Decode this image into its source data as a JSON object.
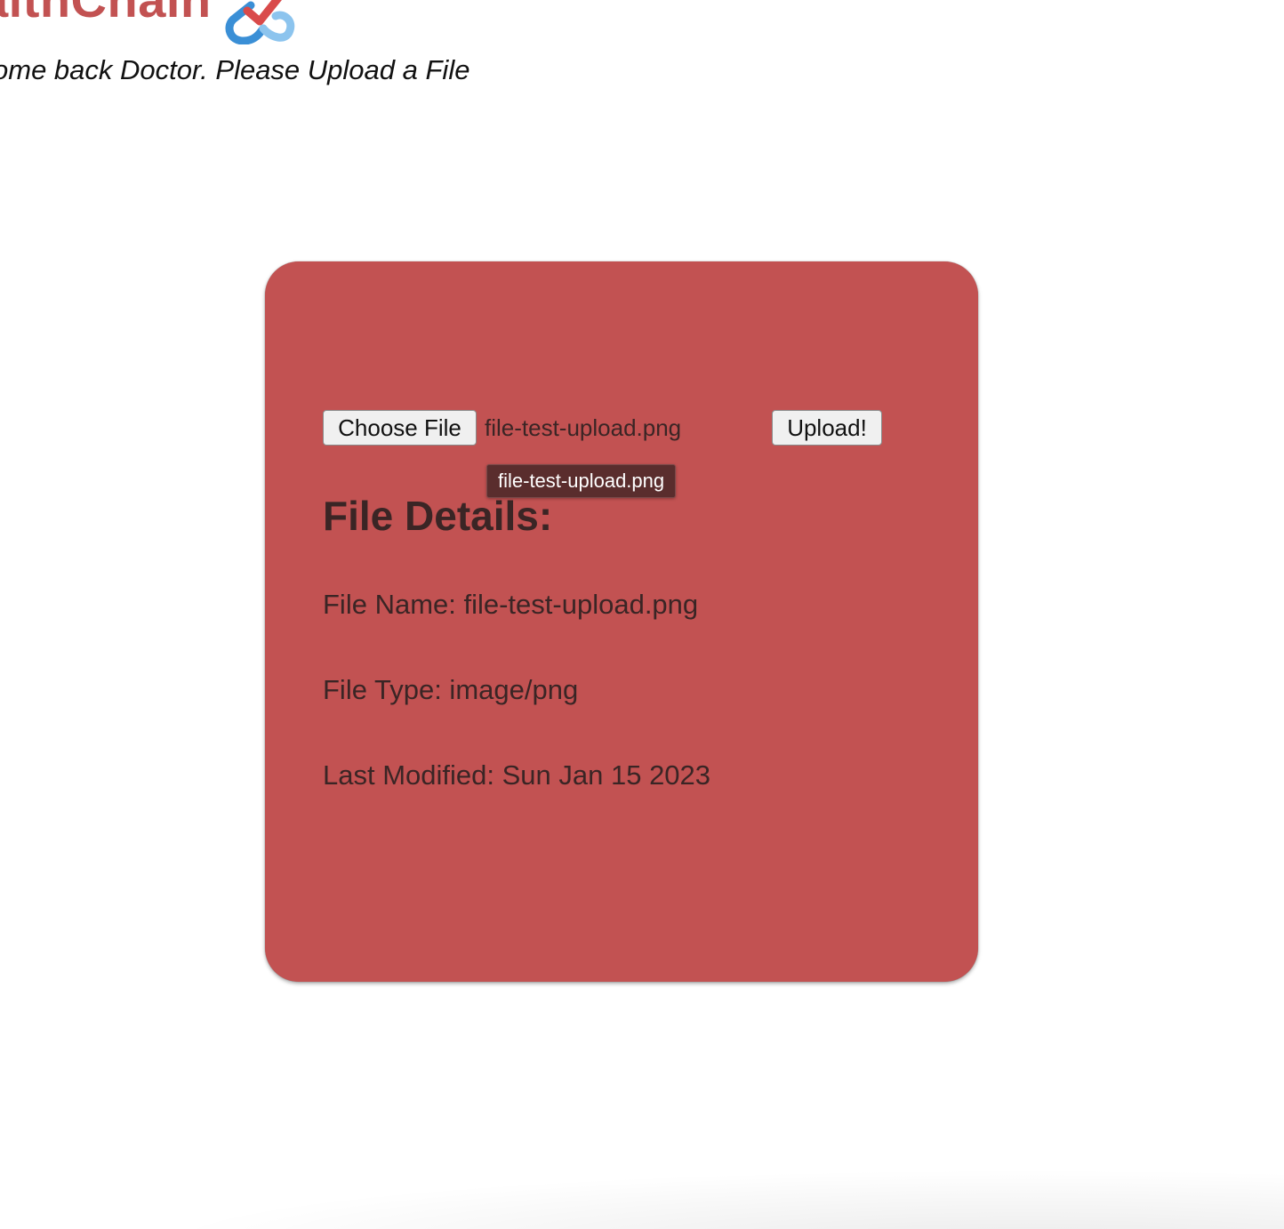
{
  "header": {
    "brand": "althChain",
    "welcome": "ome back Doctor. Please Upload a File"
  },
  "upload_form": {
    "choose_label": "Choose File",
    "chosen_file": "file-test-upload.png",
    "upload_label": "Upload!",
    "tooltip": "file-test-upload.png"
  },
  "details": {
    "title": "File Details:",
    "name_line": "File Name: file-test-upload.png",
    "type_line": "File Type: image/png",
    "modified_line": "Last Modified: Sun Jan 15 2023"
  },
  "colors": {
    "brand": "#c25252",
    "card": "#c25252",
    "logo_blue": "#3a8fd6",
    "logo_red": "#d94a4a"
  },
  "icons": {
    "logo": "chain-check-logo-icon"
  }
}
